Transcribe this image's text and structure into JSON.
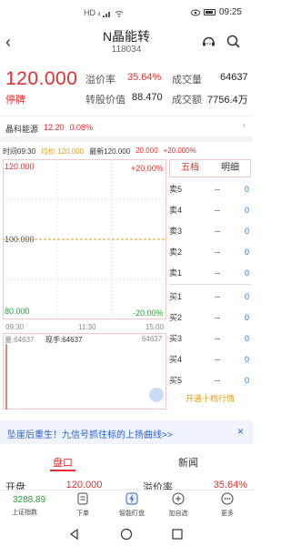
{
  "status": {
    "left": "HD ᵢₗ",
    "time": "09:25"
  },
  "header": {
    "name": "N晶能转",
    "code": "118034"
  },
  "quote": {
    "price": "120.000",
    "state": "停牌",
    "premium_label": "溢价率",
    "premium_value": "35.64%",
    "volume_label": "成交量",
    "volume_value": "64637",
    "conv_label": "转股价值",
    "conv_value": "88.470",
    "amount_label": "成交额",
    "amount_value": "7756.4万"
  },
  "sector": {
    "name": "晶科能源",
    "price": "12.20",
    "change": "0.08%"
  },
  "infoline": {
    "time": "时间09:30",
    "avg": "均价:120.000",
    "last": "最新120.000",
    "chg": "20.000",
    "pct": "+20.000%"
  },
  "chart": {
    "top_price": "120.000",
    "top_pct": "+20.00%",
    "mid_price": "100.000",
    "bot_price": "80.000",
    "bot_pct": "-20.00%",
    "t0": "09:30",
    "t1": "11:30",
    "t2": "15:00",
    "vol_label": "量:64637",
    "vol_now": "现手:64637",
    "vol_axis": "64637"
  },
  "orderbook": {
    "tab1": "五档",
    "tab2": "明细",
    "asks": [
      {
        "label": "卖5",
        "price": "--",
        "vol": "0"
      },
      {
        "label": "卖4",
        "price": "--",
        "vol": "0"
      },
      {
        "label": "卖3",
        "price": "--",
        "vol": "0"
      },
      {
        "label": "卖2",
        "price": "--",
        "vol": "0"
      },
      {
        "label": "卖1",
        "price": "--",
        "vol": "0"
      }
    ],
    "bids": [
      {
        "label": "买1",
        "price": "--",
        "vol": "0"
      },
      {
        "label": "买2",
        "price": "--",
        "vol": "0"
      },
      {
        "label": "买3",
        "price": "--",
        "vol": "0"
      },
      {
        "label": "买4",
        "price": "--",
        "vol": "0"
      },
      {
        "label": "买5",
        "price": "--",
        "vol": "0"
      }
    ],
    "more": "开通十档行情"
  },
  "banner": {
    "text": "坠崖后重生！九信号抓住标的上扬曲线>>",
    "close": "×"
  },
  "tabs": {
    "t1": "盘口",
    "t2": "新闻"
  },
  "peek": {
    "a": "开盘",
    "b": "120.000",
    "c": "溢价率",
    "d": "35.64%"
  },
  "bottomnav": {
    "index_value": "3288.89",
    "index_label": "上证指数",
    "items": [
      "下单",
      "智能盯盘",
      "加自选",
      "更多"
    ]
  }
}
